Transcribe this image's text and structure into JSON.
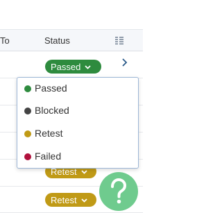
{
  "header": {
    "to_label": "To",
    "status_label": "Status",
    "menu_icon": "column-menu-icon"
  },
  "rows": [
    {
      "status": "Passed",
      "status_color": "#2e8b3e"
    },
    {
      "status": "Retest",
      "status_color": "#c09a16"
    },
    {
      "status": "Retest",
      "status_color": "#c09a16"
    }
  ],
  "dropdown": {
    "options": [
      {
        "label": "Passed",
        "color": "#2e8b3e"
      },
      {
        "label": "Blocked",
        "color": "#444444"
      },
      {
        "label": "Retest",
        "color": "#c09a16"
      },
      {
        "label": "Failed",
        "color": "#b0103c"
      }
    ]
  },
  "help": {
    "icon": "help-question-icon",
    "color": "#6fcb8e"
  }
}
